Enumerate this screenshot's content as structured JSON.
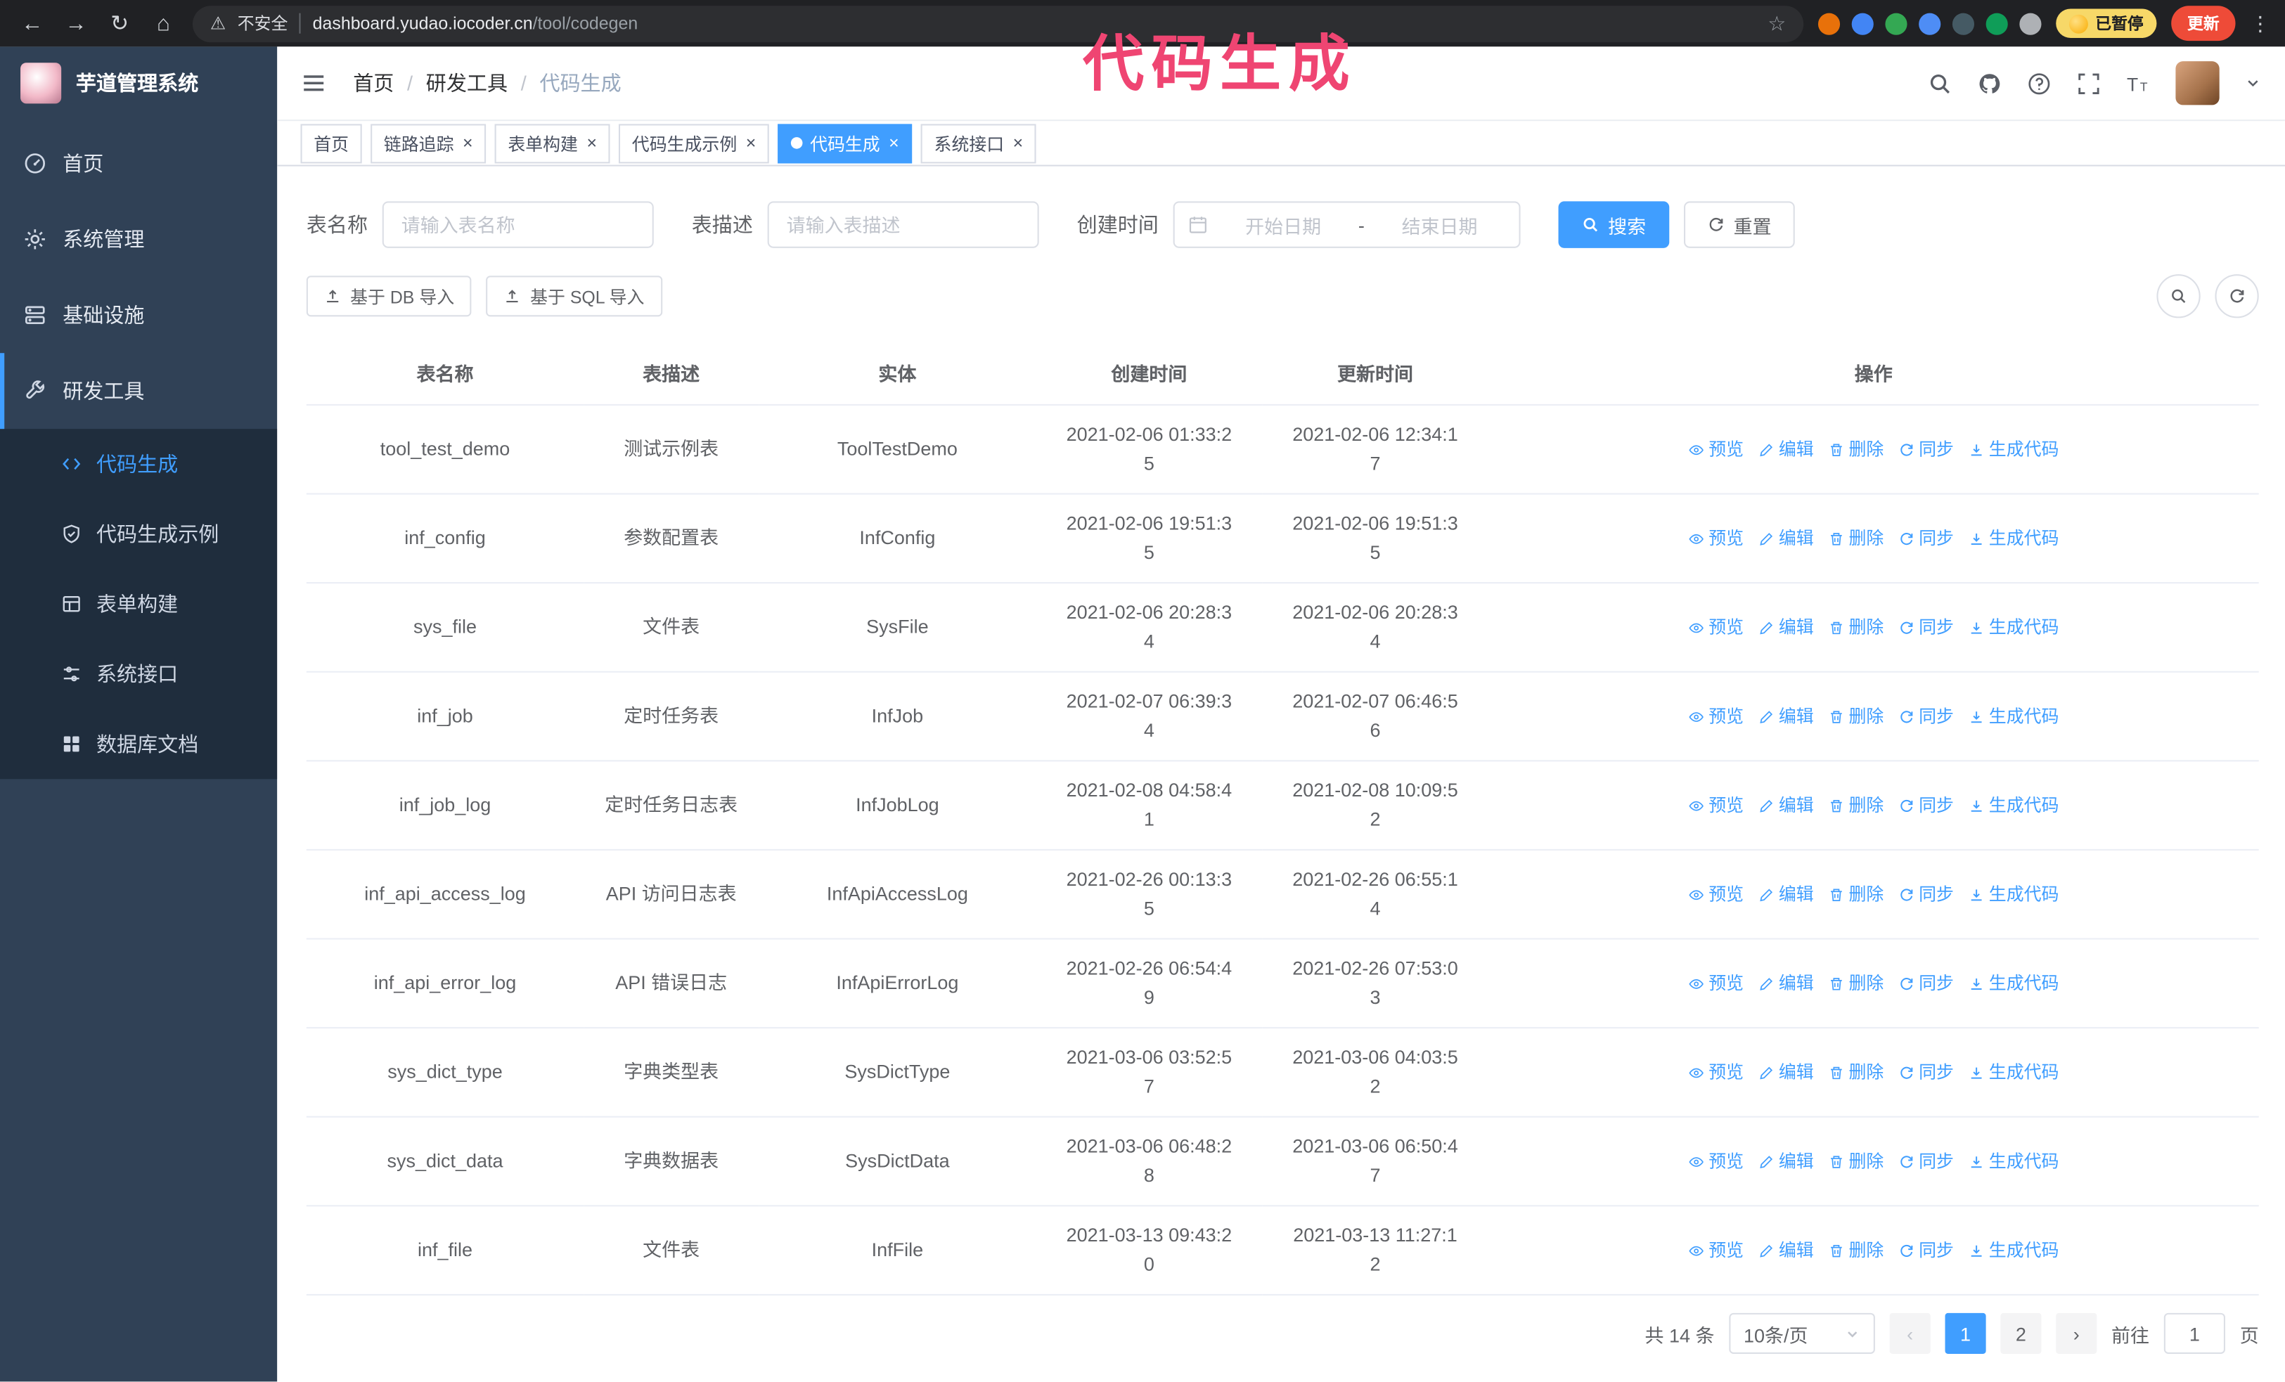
{
  "colors": {
    "accent": "#409eff",
    "sidebar_bg": "#304156",
    "submenu_bg": "#1f2d3d",
    "annotation_pink": "#ef4572",
    "update_button_bg": "#ee4b38",
    "active_tab_bg": "#409eff"
  },
  "browser": {
    "security_warning": "不安全",
    "url_domain": "dashboard.yudao.iocoder.cn",
    "url_path": "/tool/codegen",
    "paused_badge": "已暂停",
    "update_button": "更新",
    "extension_icon_colors": [
      "#e8710a",
      "#4285f4",
      "#34a853",
      "#4e8df5",
      "#455a64",
      "#0f9d58",
      "#aeb1b5"
    ]
  },
  "annotation": "代码生成",
  "sidebar": {
    "logo_title": "芋道管理系统",
    "menu": [
      {
        "label": "首页",
        "icon": "dashboard",
        "expandable": false,
        "expanded": false,
        "active": false
      },
      {
        "label": "系统管理",
        "icon": "gear",
        "expandable": true,
        "expanded": false,
        "active": false
      },
      {
        "label": "基础设施",
        "icon": "server",
        "expandable": true,
        "expanded": false,
        "active": false
      },
      {
        "label": "研发工具",
        "icon": "wrench",
        "expandable": true,
        "expanded": true,
        "active": true
      }
    ],
    "submenu": [
      {
        "label": "代码生成",
        "icon": "code",
        "active": true
      },
      {
        "label": "代码生成示例",
        "icon": "shield",
        "active": false
      },
      {
        "label": "表单构建",
        "icon": "form",
        "active": false
      },
      {
        "label": "系统接口",
        "icon": "sliders",
        "active": false
      },
      {
        "label": "数据库文档",
        "icon": "grid",
        "active": false
      }
    ]
  },
  "header": {
    "breadcrumb": [
      "首页",
      "研发工具",
      "代码生成"
    ]
  },
  "tabs": [
    {
      "label": "首页",
      "closable": false,
      "active": false
    },
    {
      "label": "链路追踪",
      "closable": true,
      "active": false
    },
    {
      "label": "表单构建",
      "closable": true,
      "active": false
    },
    {
      "label": "代码生成示例",
      "closable": true,
      "active": false
    },
    {
      "label": "代码生成",
      "closable": true,
      "active": true
    },
    {
      "label": "系统接口",
      "closable": true,
      "active": false
    }
  ],
  "filters": {
    "table_name_label": "表名称",
    "table_name_placeholder": "请输入表名称",
    "table_desc_label": "表描述",
    "table_desc_placeholder": "请输入表描述",
    "create_time_label": "创建时间",
    "date_start_placeholder": "开始日期",
    "date_separator": "-",
    "date_end_placeholder": "结束日期",
    "search_button": "搜索",
    "reset_button": "重置"
  },
  "toolbar": {
    "import_db": "基于 DB 导入",
    "import_sql": "基于 SQL 导入"
  },
  "table": {
    "columns": [
      "表名称",
      "表描述",
      "实体",
      "创建时间",
      "更新时间",
      "操作"
    ],
    "actions": [
      {
        "label": "预览",
        "icon": "eye"
      },
      {
        "label": "编辑",
        "icon": "edit"
      },
      {
        "label": "删除",
        "icon": "delete"
      },
      {
        "label": "同步",
        "icon": "sync"
      },
      {
        "label": "生成代码",
        "icon": "generate"
      }
    ],
    "rows": [
      {
        "name": "tool_test_demo",
        "desc": "测试示例表",
        "entity": "ToolTestDemo",
        "created": "2021-02-06 01:33:25",
        "updated": "2021-02-06 12:34:17"
      },
      {
        "name": "inf_config",
        "desc": "参数配置表",
        "entity": "InfConfig",
        "created": "2021-02-06 19:51:35",
        "updated": "2021-02-06 19:51:35"
      },
      {
        "name": "sys_file",
        "desc": "文件表",
        "entity": "SysFile",
        "created": "2021-02-06 20:28:34",
        "updated": "2021-02-06 20:28:34"
      },
      {
        "name": "inf_job",
        "desc": "定时任务表",
        "entity": "InfJob",
        "created": "2021-02-07 06:39:34",
        "updated": "2021-02-07 06:46:56"
      },
      {
        "name": "inf_job_log",
        "desc": "定时任务日志表",
        "entity": "InfJobLog",
        "created": "2021-02-08 04:58:41",
        "updated": "2021-02-08 10:09:52"
      },
      {
        "name": "inf_api_access_log",
        "desc": "API 访问日志表",
        "entity": "InfApiAccessLog",
        "created": "2021-02-26 00:13:35",
        "updated": "2021-02-26 06:55:14"
      },
      {
        "name": "inf_api_error_log",
        "desc": "API 错误日志",
        "entity": "InfApiErrorLog",
        "created": "2021-02-26 06:54:49",
        "updated": "2021-02-26 07:53:03"
      },
      {
        "name": "sys_dict_type",
        "desc": "字典类型表",
        "entity": "SysDictType",
        "created": "2021-03-06 03:52:57",
        "updated": "2021-03-06 04:03:52"
      },
      {
        "name": "sys_dict_data",
        "desc": "字典数据表",
        "entity": "SysDictData",
        "created": "2021-03-06 06:48:28",
        "updated": "2021-03-06 06:50:47"
      },
      {
        "name": "inf_file",
        "desc": "文件表",
        "entity": "InfFile",
        "created": "2021-03-13 09:43:20",
        "updated": "2021-03-13 11:27:12"
      }
    ]
  },
  "pagination": {
    "total": "共 14 条",
    "page_size": "10条/页",
    "pages": [
      "1",
      "2"
    ],
    "active_page": "1",
    "goto_label": "前往",
    "goto_value": "1",
    "goto_suffix": "页"
  }
}
